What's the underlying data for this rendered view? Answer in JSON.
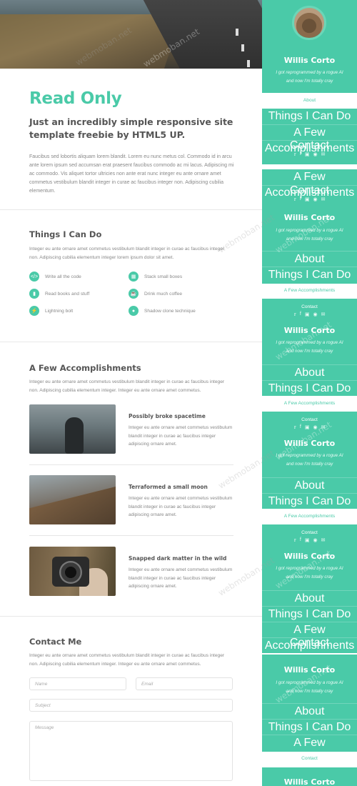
{
  "main": {
    "title": "Read Only",
    "subtitle": "Just an incredibly simple responsive site template freebie by HTML5 UP.",
    "intro_text": "Faucibus sed lobortis aliquam lorem blandit. Lorem eu nunc metus col. Commodo id in arcu ante lorem ipsum sed accumsan erat praesent faucibus commodo ac mi lacus. Adipiscing mi ac commodo. Vis aliquet tortor ultricies non ante erat nunc integer eu ante ornare amet commetus vestibulum blandit integer in curae ac faucibus integer non. Adipiscing cubilia elementum.",
    "skills_section": {
      "title": "Things I Can Do",
      "text": "Integer eu ante ornare amet commetus vestibulum blandit integer in curae ac faucibus integer non. Adipiscing cubilia elementum integer lorem ipsum dolor sit amet.",
      "items": [
        {
          "label": "Write all the code",
          "icon": "code-icon"
        },
        {
          "label": "Stack small boxes",
          "icon": "cubes-icon"
        },
        {
          "label": "Read books and stuff",
          "icon": "book-icon"
        },
        {
          "label": "Drink much coffee",
          "icon": "coffee-icon"
        },
        {
          "label": "Lightning bolt",
          "icon": "bolt-icon"
        },
        {
          "label": "Shadow clone technique",
          "icon": "users-icon"
        }
      ]
    },
    "accomplishments": {
      "title": "A Few Accomplishments",
      "text": "Integer eu ante ornare amet commetus vestibulum blandit integer in curae ac faucibus integer non. Adipiscing cubilia elementum integer. Integer eu ante ornare amet commetus.",
      "items": [
        {
          "title": "Possibly broke spacetime",
          "text": "Integer eu ante ornare amet commetus vestibulum blandit integer in curae ac faucibus integer adipiscing ornare amet."
        },
        {
          "title": "Terraformed a small moon",
          "text": "Integer eu ante ornare amet commetus vestibulum blandit integer in curae ac faucibus integer adipiscing ornare amet."
        },
        {
          "title": "Snapped dark matter in the wild",
          "text": "Integer eu ante ornare amet commetus vestibulum blandit integer in curae ac faucibus integer adipiscing ornare amet."
        }
      ]
    },
    "contact": {
      "title": "Contact Me",
      "text": "Integer eu ante ornare amet commetus vestibulum blandit integer in curae ac faucibus integer non. Adipiscing cubilia elementum integer. Integer eu ante ornare amet commetus.",
      "name_placeholder": "Name",
      "email_placeholder": "Email",
      "subject_placeholder": "Subject",
      "message_placeholder": "Message"
    }
  },
  "sidebar": {
    "name": "Willis Corto",
    "tagline": "I got reprogrammed by a rogue AI and now I'm totally cray",
    "nav": [
      "About",
      "Things I Can Do",
      "A Few Accomplishments",
      "Contact"
    ],
    "social_icons": [
      "twitter-icon",
      "facebook-icon",
      "instagram-icon",
      "github-icon",
      "email-icon"
    ]
  },
  "watermark": "webmoban.net",
  "colors": {
    "accent": "#4acaa8",
    "heading": "#555555",
    "text": "#888888"
  }
}
